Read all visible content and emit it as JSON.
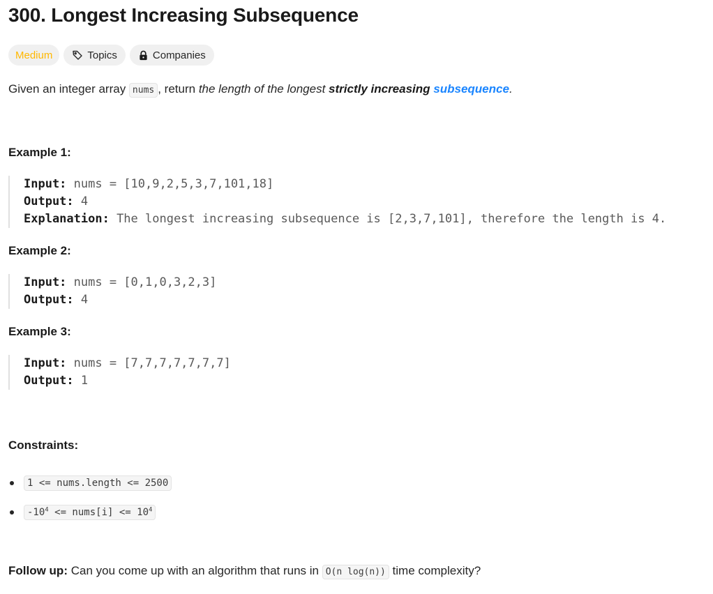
{
  "problem": {
    "title": "300. Longest Increasing Subsequence",
    "difficulty": "Medium",
    "tags": {
      "topics": "Topics",
      "companies": "Companies"
    },
    "description": {
      "prefix": "Given an integer array ",
      "code": "nums",
      "mid": ", return ",
      "italic": "the length of the longest ",
      "strong": "strictly increasing",
      "space": " ",
      "link": "subsequence",
      "end": "."
    }
  },
  "examples": [
    {
      "heading": "Example 1:",
      "input_label": "Input:",
      "input_value": " nums = [10,9,2,5,3,7,101,18]",
      "output_label": "Output:",
      "output_value": " 4",
      "explanation_label": "Explanation:",
      "explanation_value": " The longest increasing subsequence is [2,3,7,101], therefore the length is 4."
    },
    {
      "heading": "Example 2:",
      "input_label": "Input:",
      "input_value": " nums = [0,1,0,3,2,3]",
      "output_label": "Output:",
      "output_value": " 4"
    },
    {
      "heading": "Example 3:",
      "input_label": "Input:",
      "input_value": " nums = [7,7,7,7,7,7,7]",
      "output_label": "Output:",
      "output_value": " 1"
    }
  ],
  "constraints": {
    "heading": "Constraints:",
    "c1": "1 <= nums.length <= 2500",
    "c2": {
      "a": "-10",
      "a_exp": "4",
      "b": " <= nums[i] <= 10",
      "b_exp": "4"
    }
  },
  "followup": {
    "label": "Follow up:",
    "text1": " Can you come up with an algorithm that runs in ",
    "code": "O(n log(n))",
    "text2": " time complexity?"
  },
  "colors": {
    "difficulty_medium": "#ffb800",
    "link": "#1a85ff"
  },
  "icons": {
    "topics": "tag-icon",
    "companies": "lock-icon"
  }
}
